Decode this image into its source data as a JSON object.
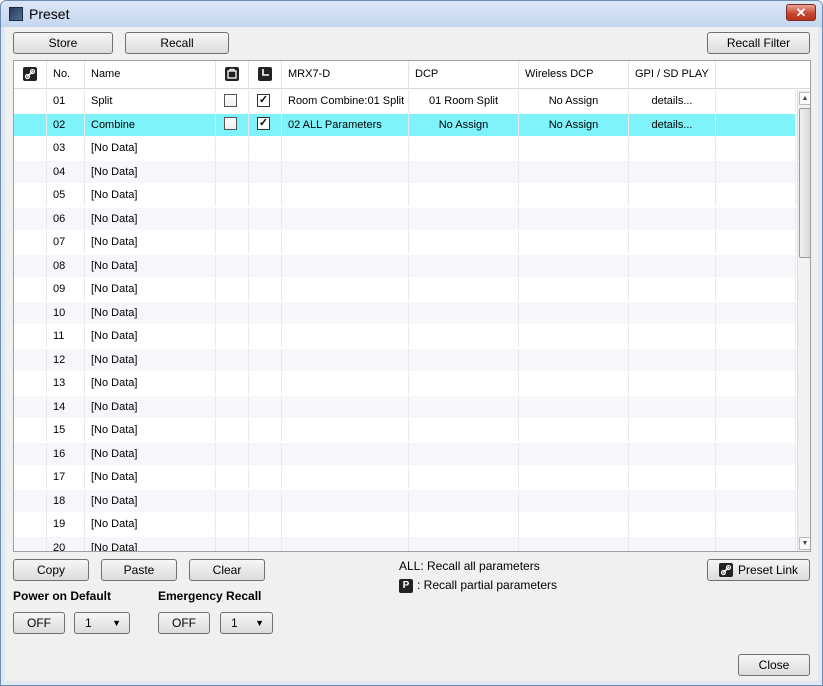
{
  "window": {
    "title": "Preset",
    "close_glyph": "✕"
  },
  "toolbar": {
    "store": "Store",
    "recall": "Recall",
    "recall_filter": "Recall Filter"
  },
  "grid": {
    "columns": {
      "no": "No.",
      "name": "Name",
      "mrx": "MRX7-D",
      "dcp": "DCP",
      "wireless": "Wireless DCP",
      "gpi": "GPI / SD PLAY"
    },
    "rows": [
      {
        "no": "01",
        "name": "Split",
        "protect": false,
        "scheduler": true,
        "mrx": "Room Combine:01 Split",
        "dcp": "01 Room Split",
        "wireless": "No Assign",
        "gpi": "details..."
      },
      {
        "no": "02",
        "name": "Combine",
        "protect": false,
        "scheduler": true,
        "mrx": "02 ALL Parameters",
        "dcp": "No Assign",
        "wireless": "No Assign",
        "gpi": "details..."
      },
      {
        "no": "03",
        "name": "[No Data]"
      },
      {
        "no": "04",
        "name": "[No Data]"
      },
      {
        "no": "05",
        "name": "[No Data]"
      },
      {
        "no": "06",
        "name": "[No Data]"
      },
      {
        "no": "07",
        "name": "[No Data]"
      },
      {
        "no": "08",
        "name": "[No Data]"
      },
      {
        "no": "09",
        "name": "[No Data]"
      },
      {
        "no": "10",
        "name": "[No Data]"
      },
      {
        "no": "11",
        "name": "[No Data]"
      },
      {
        "no": "12",
        "name": "[No Data]"
      },
      {
        "no": "13",
        "name": "[No Data]"
      },
      {
        "no": "14",
        "name": "[No Data]"
      },
      {
        "no": "15",
        "name": "[No Data]"
      },
      {
        "no": "16",
        "name": "[No Data]"
      },
      {
        "no": "17",
        "name": "[No Data]"
      },
      {
        "no": "18",
        "name": "[No Data]"
      },
      {
        "no": "19",
        "name": "[No Data]"
      },
      {
        "no": "20",
        "name": "[No Data]"
      }
    ],
    "selected_row": "02"
  },
  "edit": {
    "copy": "Copy",
    "paste": "Paste",
    "clear": "Clear"
  },
  "legend": {
    "all": "ALL: Recall all parameters",
    "partial_badge": "P",
    "partial": ": Recall partial parameters"
  },
  "preset_link": "Preset Link",
  "power_on_default": {
    "label": "Power on Default",
    "off": "OFF",
    "value": "1"
  },
  "emergency_recall": {
    "label": "Emergency Recall",
    "off": "OFF",
    "value": "1"
  },
  "close": "Close",
  "icons": {
    "link_header": "link-icon",
    "protect_header": "lock-icon",
    "scheduler_header": "clock-icon"
  },
  "colors": {
    "selected_row": "#7ef3fb",
    "title_bar": "#c4d6ee"
  }
}
